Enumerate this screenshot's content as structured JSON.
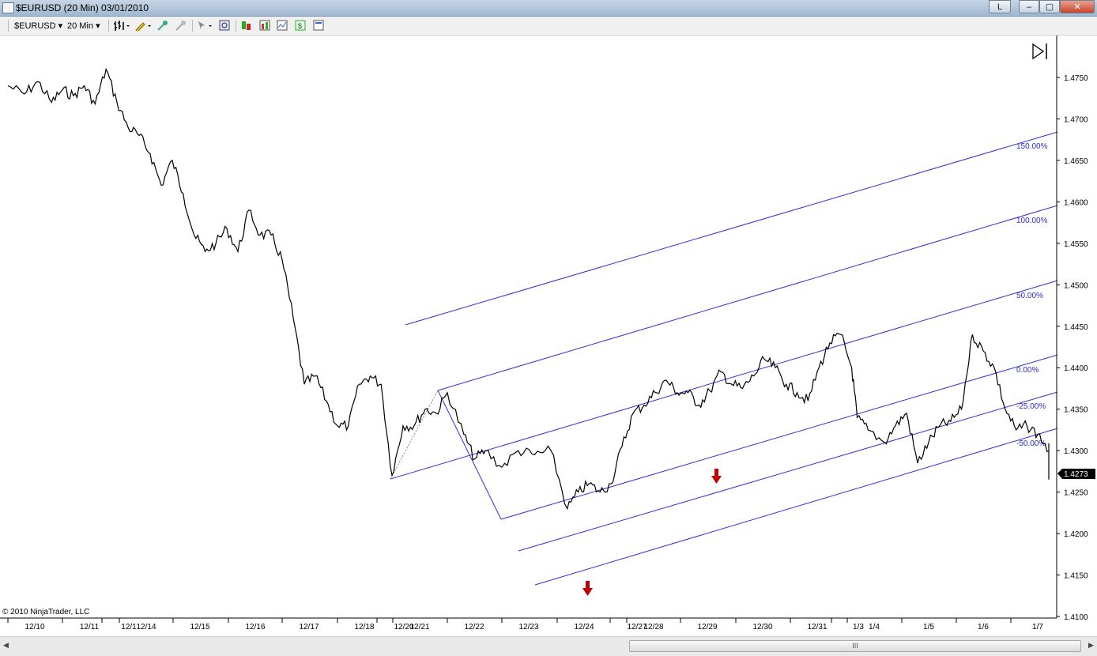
{
  "window": {
    "title": "$EURUSD (20 Min)  03/01/2010",
    "buttons": {
      "l": "L",
      "minimize": "–",
      "maximize": "▢",
      "close": "✕"
    }
  },
  "toolbar": {
    "instrument": "$EURUSD",
    "interval": "20 Min",
    "icons": [
      "bar-type-icon",
      "draw-tool-icon",
      "add-strategy-icon",
      "remove-strategy-icon",
      "cursor-icon",
      "zoom-icon",
      "indicators-icon",
      "strategies-icon",
      "properties-icon",
      "data-box-icon",
      "chart-trader-icon"
    ]
  },
  "colors": {
    "price": "#000000",
    "channel": "#2f2fdc",
    "arrow": "#c00000",
    "price_marker": "#000000"
  },
  "chart_data": {
    "type": "line",
    "title": "",
    "xlabel": "",
    "ylabel": "",
    "x_ticks": [
      "12/10",
      "12/11",
      "12/1",
      "12/14",
      "12/15",
      "12/16",
      "12/17",
      "12/18",
      "12/20",
      "12/21",
      "12/22",
      "12/23",
      "12/24",
      "12/27",
      "12/28",
      "12/29",
      "12/30",
      "12/31",
      "1/3",
      "1/4",
      "1/5",
      "1/6",
      "1/7"
    ],
    "y_ticks": [
      "1.4750",
      "1.4700",
      "1.4650",
      "1.4600",
      "1.4550",
      "1.4500",
      "1.4450",
      "1.4400",
      "1.4350",
      "1.4300",
      "1.4250",
      "1.4200",
      "1.4150",
      "1.4100"
    ],
    "ylim": [
      1.41,
      1.478
    ],
    "last_price": "1.4273",
    "series": [
      {
        "x": [
          0,
          0.3,
          0.55,
          0.8,
          1.0,
          1.2,
          1.4,
          1.6,
          1.8,
          2.0,
          2.2,
          2.4,
          2.6,
          2.8,
          3.0,
          3.2,
          3.4,
          3.6,
          3.8,
          4.0,
          4.2,
          4.4,
          4.6,
          4.8,
          5.0,
          5.2,
          5.4,
          5.6,
          5.8,
          6.0,
          6.2,
          6.4,
          6.6,
          6.8,
          7.0,
          7.2,
          7.4,
          7.6,
          7.8,
          8.0,
          8.3,
          8.5,
          8.7,
          9.0,
          9.3,
          9.6,
          9.9,
          10.2,
          10.4,
          10.6,
          10.8,
          11.0,
          11.2,
          11.4,
          11.6,
          11.8,
          12.0,
          12.2,
          12.4,
          12.6,
          12.8,
          13.0,
          13.2,
          13.4,
          13.6,
          13.8,
          14.0,
          14.2,
          14.4,
          14.6,
          14.8,
          15.0,
          15.2,
          15.4,
          15.5,
          15.7,
          16.0,
          16.2,
          16.4,
          16.6,
          16.8,
          17.0,
          17.2,
          17.4,
          17.6,
          17.8,
          18.0,
          18.2,
          18.4,
          18.6,
          18.8,
          19.0,
          19.2,
          19.35,
          19.5
        ],
        "y": [
          1.474,
          1.473,
          1.4745,
          1.472,
          1.4735,
          1.4728,
          1.474,
          1.4718,
          1.476,
          1.472,
          1.469,
          1.468,
          1.4658,
          1.462,
          1.465,
          1.461,
          1.456,
          1.454,
          1.455,
          1.4568,
          1.454,
          1.459,
          1.456,
          1.456,
          1.453,
          1.446,
          1.438,
          1.439,
          1.436,
          1.433,
          1.433,
          1.438,
          1.439,
          1.438,
          1.427,
          1.433,
          1.433,
          1.435,
          1.4345,
          1.437,
          1.432,
          1.429,
          1.43,
          1.428,
          1.43,
          1.4295,
          1.43,
          1.423,
          1.425,
          1.426,
          1.425,
          1.426,
          1.4305,
          1.4345,
          1.4355,
          1.437,
          1.4385,
          1.437,
          1.437,
          1.4355,
          1.4372,
          1.4395,
          1.438,
          1.4375,
          1.439,
          1.441,
          1.44,
          1.438,
          1.437,
          1.436,
          1.44,
          1.443,
          1.444,
          1.44,
          1.434,
          1.4325,
          1.431,
          1.433,
          1.4345,
          1.4285,
          1.431,
          1.433,
          1.4335,
          1.435,
          1.444,
          1.442,
          1.44,
          1.435,
          1.4325,
          1.433,
          1.432,
          1.43,
          1.4305,
          1.429,
          1.4265
        ]
      }
    ],
    "channel_levels": [
      "150.00%",
      "100.00%",
      "50.00%",
      "0.00%",
      "-25.00%",
      "-50.00%"
    ],
    "annotations": [
      "down-arrow-1",
      "down-arrow-2"
    ]
  },
  "footer": {
    "copyright": "© 2010 NinjaTrader, LLC"
  },
  "scrollbar": {
    "grip": "III"
  }
}
